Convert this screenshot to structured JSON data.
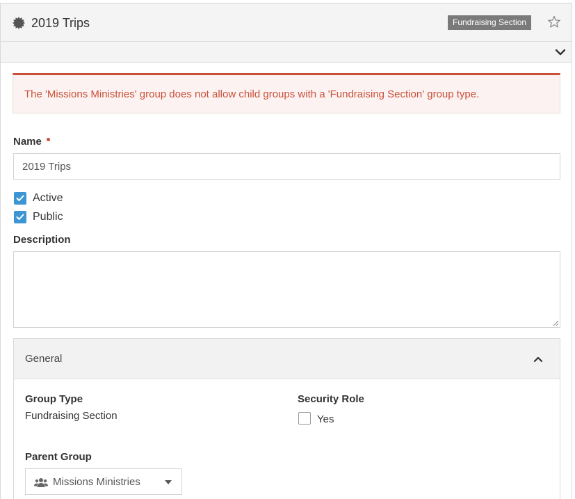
{
  "header": {
    "title": "2019 Trips",
    "group_type_badge": "Fundraising Section",
    "icons": {
      "group": "gear-icon",
      "favorite": "star-icon",
      "expand": "chevron-down-icon"
    }
  },
  "alert": {
    "message": "The 'Missions Ministries' group does not allow child groups with a 'Fundraising Section' group type.",
    "color": "#c9513a"
  },
  "form": {
    "name_label": "Name",
    "name_value": "2019 Trips",
    "active_label": "Active",
    "active_checked": true,
    "public_label": "Public",
    "public_checked": true,
    "description_label": "Description",
    "description_value": ""
  },
  "general": {
    "title": "General",
    "group_type_label": "Group Type",
    "group_type_value": "Fundraising Section",
    "security_role_label": "Security Role",
    "security_role_option": "Yes",
    "security_role_checked": false,
    "parent_group_label": "Parent Group",
    "parent_group_value": "Missions Ministries"
  },
  "colors": {
    "accent": "#3d95d3",
    "danger": "#c9513a",
    "badge": "#7a7a7a",
    "heading_bg": "#f4f4f4"
  }
}
